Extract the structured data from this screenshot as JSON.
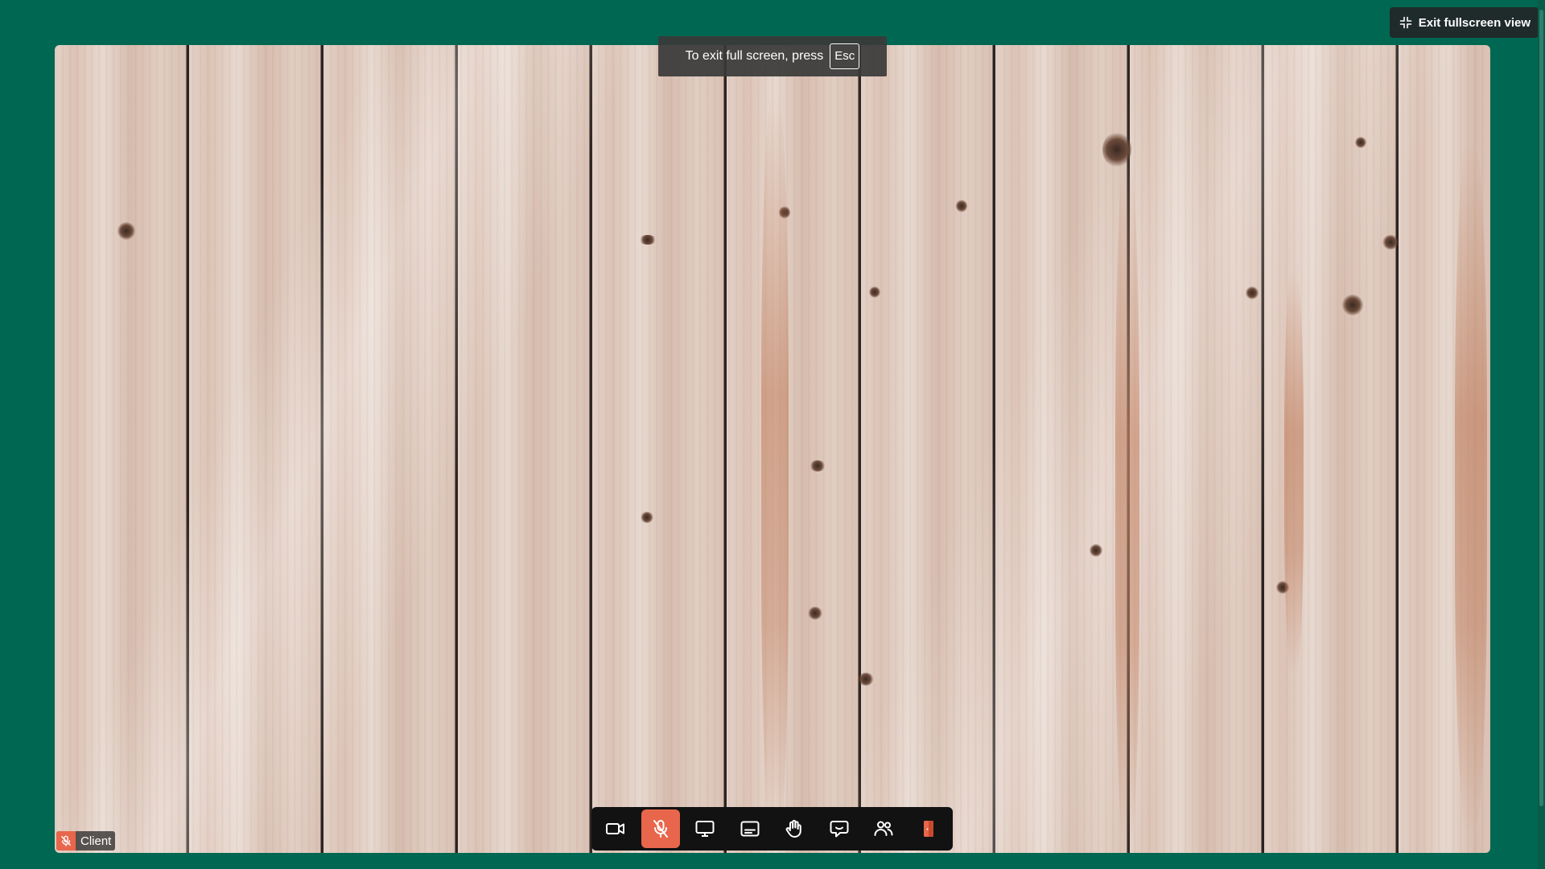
{
  "header": {
    "exit_fullscreen_label": "Exit fullscreen view"
  },
  "toast": {
    "message": "To exit full screen, press",
    "key": "Esc"
  },
  "participant": {
    "name": "Client",
    "muted": true
  },
  "controls": [
    {
      "id": "camera",
      "icon": "video-camera-icon"
    },
    {
      "id": "microphone",
      "icon": "microphone-off-icon",
      "state": "muted"
    },
    {
      "id": "share-screen",
      "icon": "monitor-share-icon"
    },
    {
      "id": "captions",
      "icon": "captions-icon"
    },
    {
      "id": "raise-hand",
      "icon": "hand-icon"
    },
    {
      "id": "chat",
      "icon": "chat-bubble-icon"
    },
    {
      "id": "participants",
      "icon": "people-icon"
    },
    {
      "id": "leave",
      "icon": "leave-door-icon"
    }
  ],
  "colors": {
    "background": "#006752",
    "control_bar": "#121212",
    "mic_off": "#e8664b",
    "leave": "#e8664b"
  }
}
